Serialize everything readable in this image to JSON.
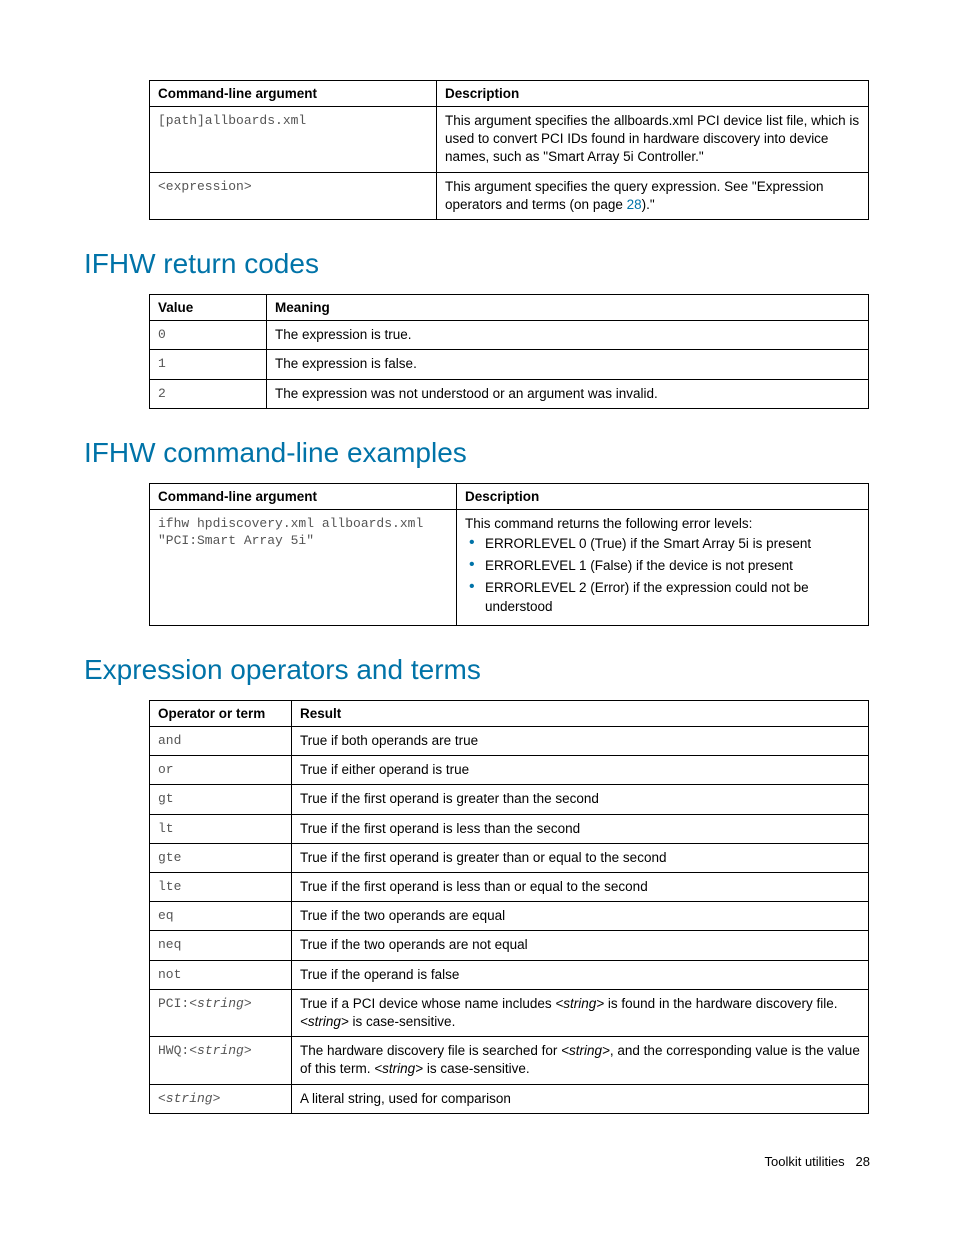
{
  "table1": {
    "headers": [
      "Command-line argument",
      "Description"
    ],
    "rows": [
      {
        "arg": "[path]allboards.xml",
        "desc": "This argument specifies the allboards.xml PCI device list file, which is used to convert PCI IDs found in hardware discovery into device names, such as \"Smart Array 5i Controller.\""
      },
      {
        "arg": "<expression>",
        "desc_prefix": "This argument specifies the query expression. See \"Expression operators and terms (on page ",
        "desc_link": "28",
        "desc_suffix": ").\""
      }
    ]
  },
  "heading1": "IFHW return codes",
  "table2": {
    "headers": [
      "Value",
      "Meaning"
    ],
    "rows": [
      {
        "val": "0",
        "meaning": "The expression is true."
      },
      {
        "val": "1",
        "meaning": "The expression is false."
      },
      {
        "val": "2",
        "meaning": "The expression was not understood or an argument was invalid."
      }
    ]
  },
  "heading2": "IFHW command-line examples",
  "table3": {
    "headers": [
      "Command-line argument",
      "Description"
    ],
    "row": {
      "arg": "ifhw hpdiscovery.xml allboards.xml \"PCI:Smart Array 5i\"",
      "desc_intro": "This command returns the following error levels:",
      "items": [
        "ERRORLEVEL 0 (True) if the Smart Array 5i is present",
        "ERRORLEVEL 1 (False) if the device is not present",
        "ERRORLEVEL 2 (Error) if the expression could not be understood"
      ]
    }
  },
  "heading3": "Expression operators and terms",
  "table4": {
    "headers": [
      "Operator or term",
      "Result"
    ],
    "rows": [
      {
        "op": "and",
        "res": "True if both operands are true",
        "mono": true
      },
      {
        "op": "or",
        "res": "True if either operand is true",
        "mono": true
      },
      {
        "op": "gt",
        "res": "True if the first operand is greater than the second",
        "mono": true
      },
      {
        "op": "lt",
        "res": "True if the first operand is less than the second",
        "mono": true
      },
      {
        "op": "gte",
        "res": "True if the first operand is greater than or equal to the second",
        "mono": true
      },
      {
        "op": "lte",
        "res": "True if the first operand is less than or equal to the second",
        "mono": true
      },
      {
        "op": "eq",
        "res": "True if the two operands are equal",
        "mono": true
      },
      {
        "op": "neq",
        "res": "True if the two operands are not equal",
        "mono": true
      },
      {
        "op": "not",
        "res": "True if the operand is false",
        "mono": true
      },
      {
        "op_prefix": "PCI:",
        "op_italic": "<string>",
        "res_prefix": "True if a PCI device whose name includes ",
        "res_mid_italic": "<string>",
        "res_mid": " is found in the hardware discovery file. ",
        "res_mid2_italic": "<string>",
        "res_suffix": " is case-sensitive.",
        "compound": true,
        "mono": true
      },
      {
        "op_prefix": "HWQ:",
        "op_italic": "<string>",
        "res_prefix": "The hardware discovery file is searched for ",
        "res_mid_italic": "<string>",
        "res_mid": ", and the corresponding value is the value of this term. ",
        "res_mid2_italic": "<string>",
        "res_suffix": " is case-sensitive.",
        "compound": true,
        "mono": true
      },
      {
        "op_italic_only": "<string>",
        "res": "A literal string, used for comparison",
        "italic_op": true
      }
    ]
  },
  "footer": {
    "label": "Toolkit utilities",
    "page": "28"
  }
}
